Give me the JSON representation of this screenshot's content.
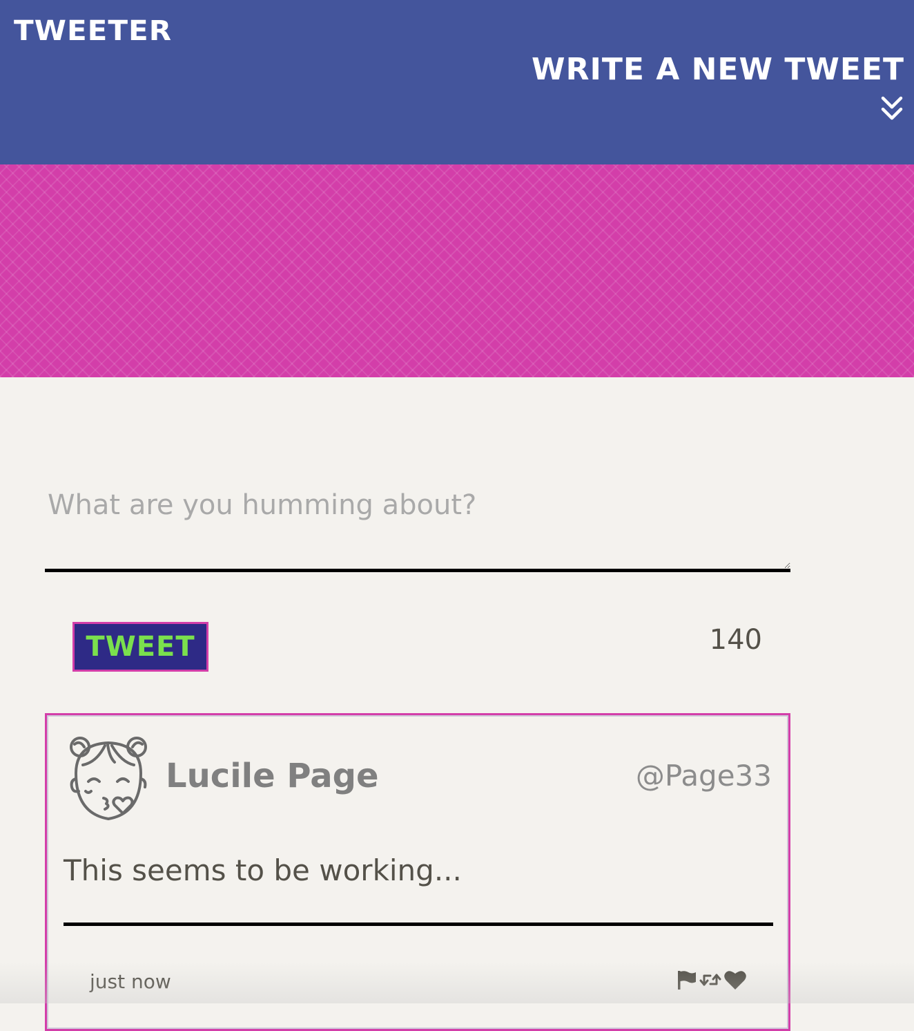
{
  "nav": {
    "brand": "TWEETER",
    "compose_toggle_label": "WRITE A NEW TWEET",
    "compose_toggle_icon": "double-chevron-down-icon"
  },
  "colors": {
    "nav_bg": "#44559c",
    "banner_bg": "#d33ea9",
    "page_bg": "#f4f2ee",
    "button_bg": "#2e2a86",
    "button_text": "#7be04d",
    "accent": "#d33ea9"
  },
  "composer": {
    "placeholder": "What are you humming about?",
    "value": "",
    "submit_label": "TWEET",
    "char_counter": "140"
  },
  "tweets": [
    {
      "avatar_icon": "kissing-girl-avatar-icon",
      "name": "Lucile Page",
      "handle": "@Page33",
      "text": "This seems to be working...",
      "timestamp": "just now",
      "actions": [
        "flag-icon",
        "retweet-icon",
        "heart-icon"
      ]
    }
  ]
}
